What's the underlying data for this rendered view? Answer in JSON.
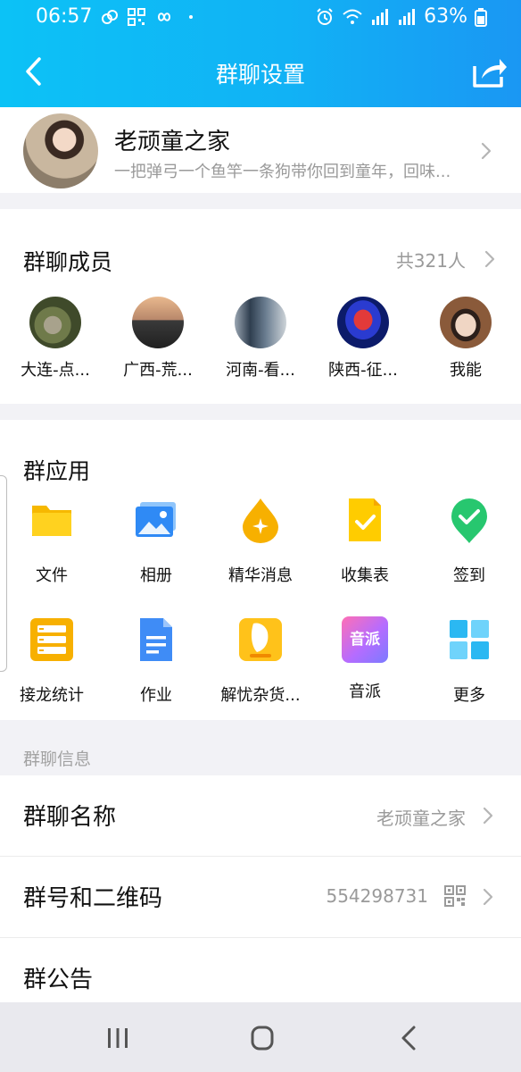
{
  "status_bar": {
    "time": "06:57",
    "battery": "63%"
  },
  "title_bar": {
    "title": "群聊设置"
  },
  "group": {
    "name": "老顽童之家",
    "description": "一把弹弓一个鱼竿一条狗带你回到童年，回味..."
  },
  "members": {
    "title": "群聊成员",
    "count": "共321人",
    "list": [
      {
        "name": "大连-点..."
      },
      {
        "name": "广西-荒..."
      },
      {
        "name": "河南-看..."
      },
      {
        "name": "陕西-征..."
      },
      {
        "name": "我能"
      }
    ]
  },
  "apps": {
    "title": "群应用",
    "items": [
      {
        "label": "文件",
        "icon": "folder-icon"
      },
      {
        "label": "相册",
        "icon": "photo-album-icon"
      },
      {
        "label": "精华消息",
        "icon": "essence-drop-icon"
      },
      {
        "label": "收集表",
        "icon": "collection-form-icon"
      },
      {
        "label": "签到",
        "icon": "check-in-icon"
      },
      {
        "label": "接龙统计",
        "icon": "relay-list-icon"
      },
      {
        "label": "作业",
        "icon": "homework-doc-icon"
      },
      {
        "label": "解忧杂货...",
        "icon": "grocery-app-icon"
      },
      {
        "label": "音派",
        "icon": "yinpai-icon",
        "icon_text": "音派"
      },
      {
        "label": "更多",
        "icon": "more-grid-icon"
      }
    ]
  },
  "info": {
    "header": "群聊信息",
    "rows": [
      {
        "label": "群聊名称",
        "value": "老顽童之家"
      },
      {
        "label": "群号和二维码",
        "value": "554298731"
      },
      {
        "label": "群公告",
        "value": ""
      }
    ]
  },
  "colors": {
    "header_gradient_start": "#0cc2f6",
    "header_gradient_end": "#1a97f3",
    "secondary_text": "#9a9a9a"
  }
}
